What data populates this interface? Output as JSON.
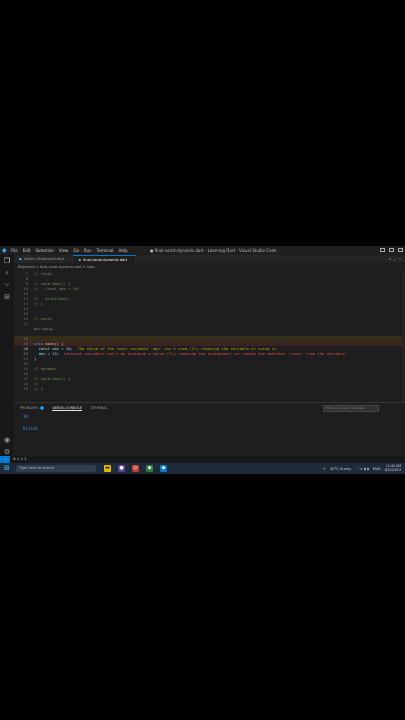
{
  "titlebar": {
    "menu": [
      "File",
      "Edit",
      "Selection",
      "View",
      "Go",
      "Run",
      "Terminal",
      "Help"
    ],
    "window_title": "● final-const-dynamic.dart - Learning Dart - Visual Studio Code"
  },
  "tabs": [
    {
      "label": "Switch-Statement.dart",
      "active": false
    },
    {
      "label": "final-const-dynamic.dart",
      "active": true
    }
  ],
  "breadcrumb": "Beginners > final-const-dynamic.dart > main",
  "editor": {
    "lines": [
      {
        "n": "7",
        "text": "// final"
      },
      {
        "n": "8",
        "text": ""
      },
      {
        "n": "9",
        "text": "// void main() {"
      },
      {
        "n": "10",
        "text": "//   final abc = 10;"
      },
      {
        "n": "11",
        "text": ""
      },
      {
        "n": "12",
        "text": "//   print(abc);"
      },
      {
        "n": "13",
        "text": "// }"
      },
      {
        "n": "14",
        "text": ""
      },
      {
        "n": "15",
        "text": ""
      },
      {
        "n": "16",
        "text": "// const"
      },
      {
        "n": "17",
        "text": ""
      }
    ],
    "codelens": "Run | Debug",
    "main_line": {
      "n": "18",
      "kw": "void",
      "fn": "main",
      "rest": "() {"
    },
    "warn_line": {
      "n": "19",
      "code": "const abc = 10;",
      "msg": "The value of the local variable 'abc' isn't used.(Try removing the variable or using it."
    },
    "err_line": {
      "n": "20",
      "code": "abc = 15;",
      "msg": "Constant variables can't be assigned a value.(Try removing the assignment, or remove the modifier 'const' from the variable."
    },
    "close_line": {
      "n": "21",
      "text": "}"
    },
    "lines_after": [
      {
        "n": "22",
        "text": ""
      },
      {
        "n": "23",
        "text": ""
      },
      {
        "n": "24",
        "text": ""
      },
      {
        "n": "25",
        "text": "// dynamic"
      },
      {
        "n": "26",
        "text": ""
      },
      {
        "n": "27",
        "text": "// void main() {"
      },
      {
        "n": "28",
        "text": "//"
      },
      {
        "n": "29",
        "text": "// }"
      }
    ]
  },
  "panel": {
    "tabs": [
      "PROBLEMS",
      "DEBUG CONSOLE",
      "TERMINAL"
    ],
    "problems_count": "2",
    "filter_placeholder": "Filter (e.g. text, !exclude)",
    "console": [
      "10",
      "Exited."
    ]
  },
  "statusbar": {
    "left": "⊗ 1 ⚠ 1"
  },
  "taskbar": {
    "search_placeholder": "Type here to search",
    "weather": "30°C Sunny",
    "lang": "ENG",
    "time": "11:44 AM",
    "date": "8/22/2023"
  },
  "colors": {
    "accent": "#0078d4",
    "warning": "#cca700",
    "error": "#f14c4c"
  }
}
